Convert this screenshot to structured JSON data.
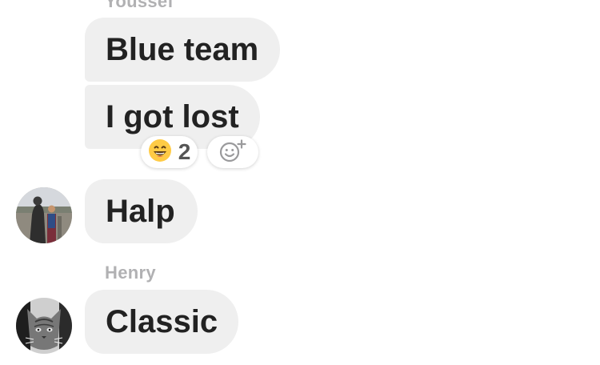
{
  "messages": [
    {
      "sender": "Youssef",
      "text": "Blue team"
    },
    {
      "text": "I got lost",
      "reaction": {
        "emoji": "😄",
        "count": "2"
      }
    },
    {
      "text": "Halp"
    },
    {
      "sender": "Henry",
      "text": "Classic"
    }
  ],
  "colors": {
    "bubble": "#efefef",
    "text": "#222222",
    "sender": "#b1b1b3",
    "emoji_yellow": "#ffcb45"
  },
  "icons": {
    "reaction_emoji": "grinning-face-icon",
    "add_reaction": "add-reaction-icon"
  }
}
